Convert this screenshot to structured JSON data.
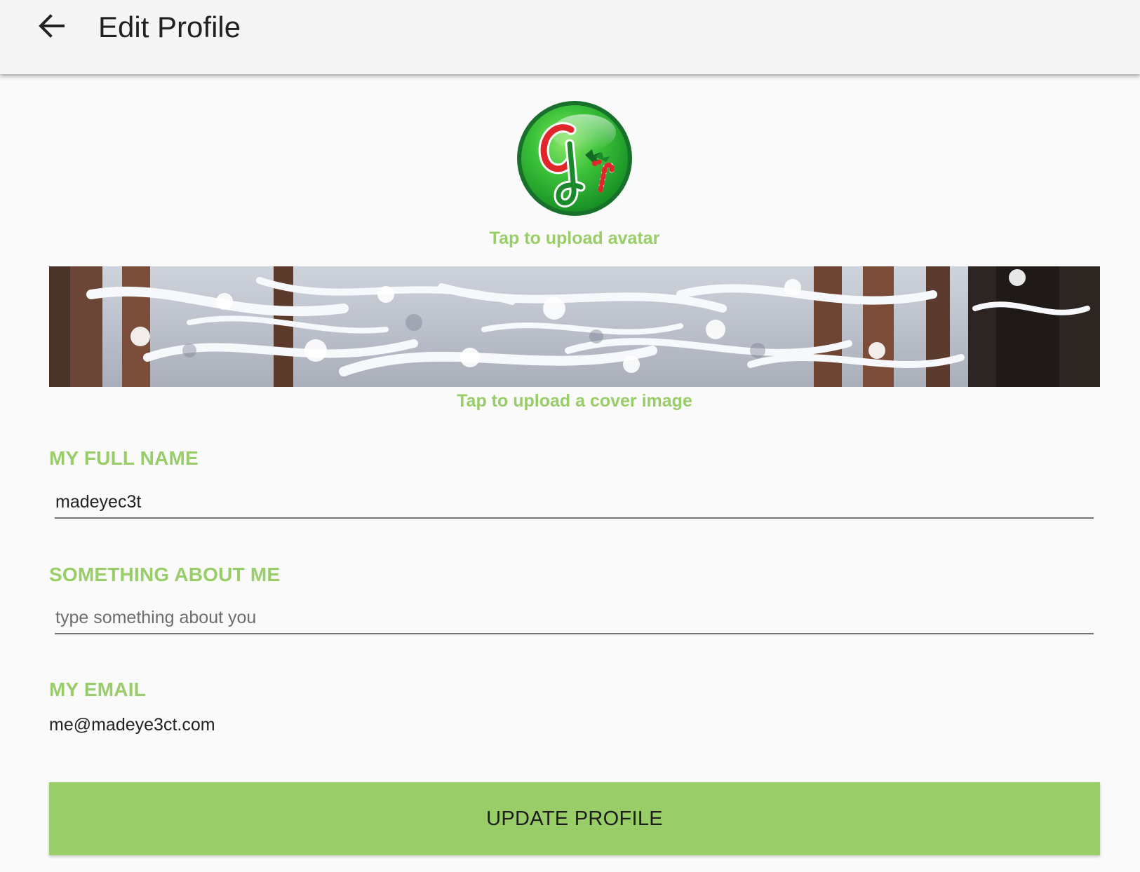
{
  "appbar": {
    "title": "Edit Profile",
    "back_icon": "arrow-left-icon"
  },
  "avatar": {
    "caption": "Tap to upload avatar",
    "colors": {
      "ring": "#1e7d2c",
      "fill": "#3cc23a",
      "letter_red": "#e0252b",
      "letter_green": "#1b8a2d"
    }
  },
  "cover": {
    "caption": "Tap to upload a cover image"
  },
  "form": {
    "full_name": {
      "label": "MY FULL NAME",
      "value": "madeyec3t"
    },
    "about": {
      "label": "SOMETHING ABOUT ME",
      "placeholder": "type something about you",
      "value": ""
    },
    "email": {
      "label": "MY EMAIL",
      "value": "me@madeye3ct.com"
    }
  },
  "actions": {
    "update_label": "UPDATE PROFILE"
  },
  "colors": {
    "accent": "#98cd68",
    "appbar_bg": "#f5f5f5",
    "page_bg": "#fafafa",
    "text_primary": "#212121"
  }
}
